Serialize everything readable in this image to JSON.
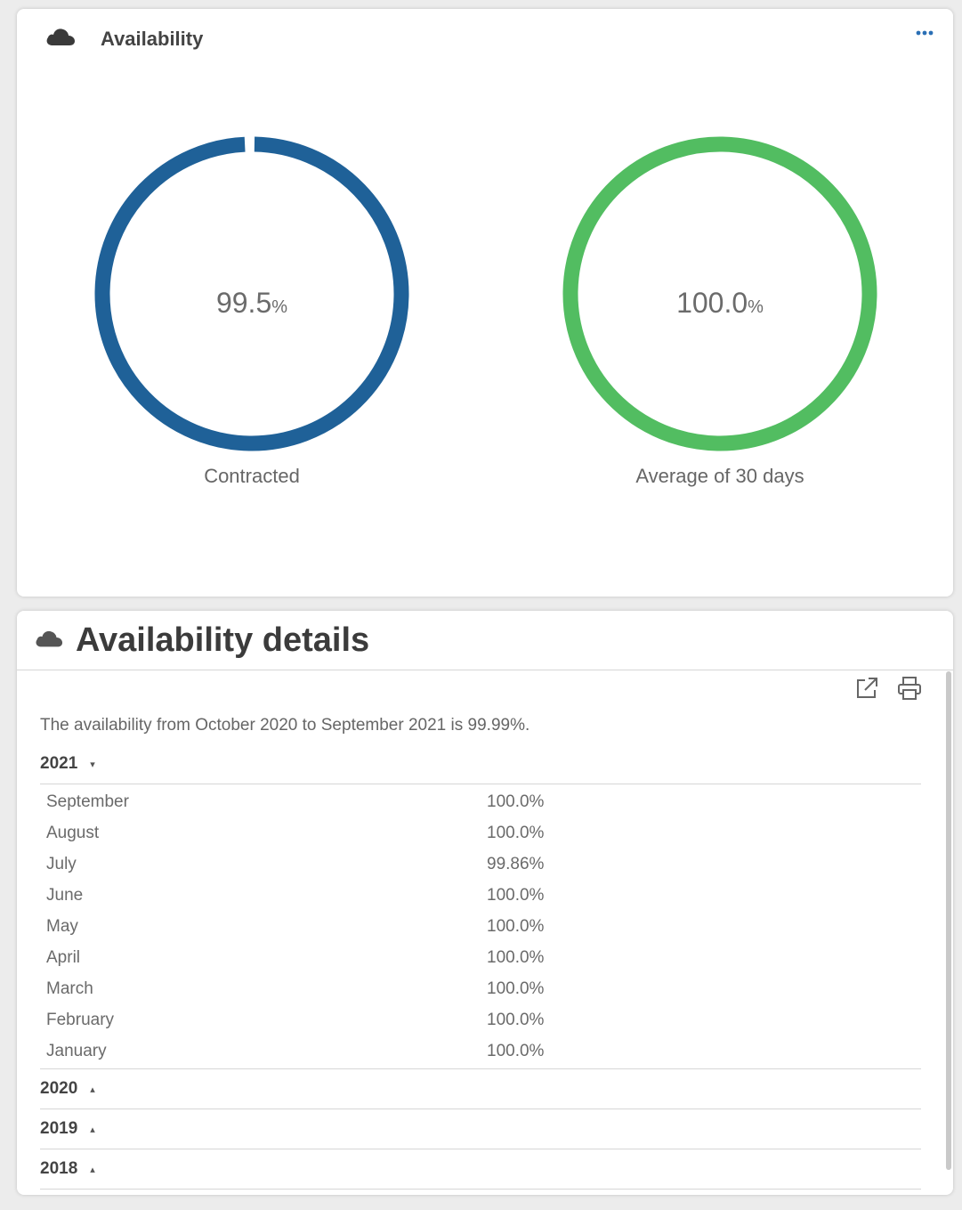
{
  "availability_card": {
    "title": "Availability",
    "icon": "cloud-icon",
    "menu_icon": "more-horizontal-icon",
    "gauges": [
      {
        "id": "contracted",
        "value": "99.5",
        "unit": "%",
        "label": "Contracted",
        "fraction": 0.995,
        "color": "#1f6198"
      },
      {
        "id": "average",
        "value": "100.0",
        "unit": "%",
        "label": "Average of 30 days",
        "fraction": 1.0,
        "color": "#52bd61"
      }
    ]
  },
  "details_card": {
    "title": "Availability details",
    "icon": "cloud-icon",
    "toolbar": {
      "export_icon": "external-link-icon",
      "print_icon": "printer-icon"
    },
    "summary": "The availability from October 2020 to September 2021 is 99.99%.",
    "years": [
      {
        "year": "2021",
        "caret": "▾",
        "expanded": true,
        "months": [
          {
            "month": "September",
            "value": "100.0%"
          },
          {
            "month": "August",
            "value": "100.0%"
          },
          {
            "month": "July",
            "value": "99.86%"
          },
          {
            "month": "June",
            "value": "100.0%"
          },
          {
            "month": "May",
            "value": "100.0%"
          },
          {
            "month": "April",
            "value": "100.0%"
          },
          {
            "month": "March",
            "value": "100.0%"
          },
          {
            "month": "February",
            "value": "100.0%"
          },
          {
            "month": "January",
            "value": "100.0%"
          }
        ]
      },
      {
        "year": "2020",
        "caret": "▴",
        "expanded": false
      },
      {
        "year": "2019",
        "caret": "▴",
        "expanded": false
      },
      {
        "year": "2018",
        "caret": "▴",
        "expanded": false
      }
    ]
  }
}
